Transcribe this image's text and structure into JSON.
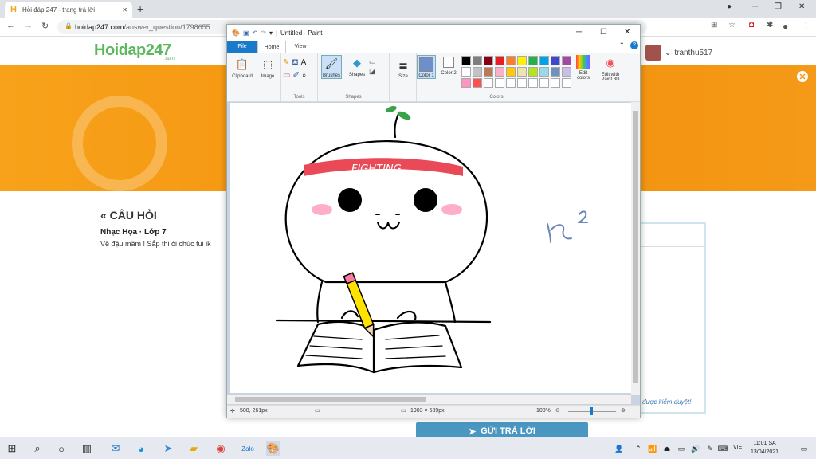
{
  "browser": {
    "tab_title": "Hỏi đáp 247 - trang trả lời",
    "favicon_letter": "H",
    "url_host": "hoidap247.com",
    "url_path": "/answer_question/1798655",
    "new_tab": "+",
    "win_min": "─",
    "win_max": "❐",
    "win_close": "✕",
    "tab_close": "✕"
  },
  "site": {
    "logo_main": "Hoidap247",
    "logo_sub": ".com",
    "user_name": "tranthu517",
    "question_heading": "« CÂU HỎI",
    "question_subject": "Nhạc Họa · Lớp 7",
    "question_text": "Vẽ đậu mầm ! Sắp thi ỏi chúc tui ik",
    "pending_note": "được kiểm duyệt!",
    "submit_label": "GỬI TRẢ LỜI",
    "close_banner": "✕"
  },
  "paint": {
    "title": "Untitled - Paint",
    "menu_file": "File",
    "menu_home": "Home",
    "menu_view": "View",
    "groups": {
      "clipboard": "Clipboard",
      "image": "Image",
      "tools": "Tools",
      "brushes": "Brushes",
      "shapes_btn": "Shapes",
      "shapes": "Shapes",
      "size": "Size",
      "color1": "Color 1",
      "color2": "Color 2",
      "colors": "Colors",
      "edit_colors": "Edit colors",
      "edit_paint3d": "Edit with Paint 3D"
    },
    "palette": [
      "#000000",
      "#7f7f7f",
      "#880015",
      "#ed1c24",
      "#ff7f27",
      "#fff200",
      "#22b14c",
      "#00a2e8",
      "#3f48cc",
      "#a349a4",
      "#ffffff",
      "#c3c3c3",
      "#b97a57",
      "#ffaec9",
      "#ffc90e",
      "#efe4b0",
      "#b5e61d",
      "#99d9ea",
      "#7092be",
      "#c8bfe7",
      "#ff93c1",
      "#ff5050"
    ],
    "color1_value": "#6f8fc8",
    "color2_value": "#ffffff",
    "drawing_headband_text": "FIGHTING",
    "status_pos": "508, 261px",
    "status_size": "1903 × 689px",
    "zoom": "100%"
  },
  "taskbar": {
    "time": "11:01 SA",
    "date": "13/04/2021",
    "lang": "VIE"
  }
}
